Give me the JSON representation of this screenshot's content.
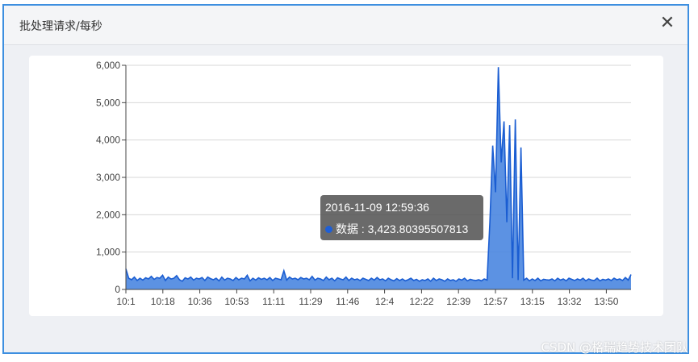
{
  "dialog": {
    "title": "批处理请求/每秒",
    "close_icon": "close-icon",
    "close_glyph": "✕"
  },
  "tooltip": {
    "time": "2016-11-09 12:59:36",
    "series_label": "数据",
    "separator": " : ",
    "value": "3,423.80395507813"
  },
  "watermark": "CSDN @格瑞趋势技术团队",
  "colors": {
    "line": "#1a5dd2",
    "area": "#4a86e0",
    "tooltip_dot": "#1e5fd6",
    "border": "#3d8fe0"
  },
  "chart_data": {
    "type": "area",
    "title": "",
    "xlabel": "",
    "ylabel": "",
    "ylim": [
      0,
      6000
    ],
    "yticks": [
      0,
      1000,
      2000,
      3000,
      4000,
      5000,
      6000
    ],
    "ytick_labels": [
      "0",
      "1,000",
      "2,000",
      "3,000",
      "4,000",
      "5,000",
      "6,000"
    ],
    "xtick_labels": [
      "10:1",
      "10:18",
      "10:36",
      "10:53",
      "11:11",
      "11:29",
      "11:46",
      "12:4",
      "12:22",
      "12:39",
      "12:57",
      "13:15",
      "13:32",
      "13:50"
    ],
    "grid": true,
    "series": [
      {
        "values": [
          550,
          300,
          260,
          330,
          240,
          300,
          250,
          310,
          280,
          350,
          270,
          320,
          300,
          380,
          240,
          330,
          280,
          300,
          370,
          260,
          220,
          310,
          280,
          330,
          250,
          300,
          280,
          320,
          240,
          330,
          290,
          260,
          300,
          230,
          330,
          250,
          300,
          280,
          240,
          320,
          260,
          300,
          280,
          380,
          230,
          300,
          250,
          310,
          270,
          300,
          260,
          320,
          240,
          300,
          280,
          260,
          500,
          250,
          330,
          280,
          300,
          260,
          320,
          280,
          300,
          260,
          350,
          250,
          300,
          280,
          240,
          330,
          260,
          300,
          230,
          310,
          280,
          260,
          330,
          240,
          300,
          260,
          280,
          240,
          300,
          270,
          240,
          300,
          250,
          320,
          260,
          280,
          230,
          300,
          260,
          230,
          290,
          240,
          280,
          230,
          260,
          300,
          240,
          270,
          220,
          260,
          240,
          280,
          220,
          300,
          240,
          280,
          260,
          220,
          280,
          240,
          260,
          220,
          280,
          250,
          300,
          230,
          270,
          250,
          240,
          260,
          230,
          280,
          250,
          1800,
          3850,
          2600,
          5950,
          3400,
          4500,
          1800,
          4400,
          300,
          4550,
          250,
          3800,
          250,
          300,
          230,
          280,
          240,
          300,
          230,
          270,
          260,
          250,
          280,
          230,
          300,
          250,
          280,
          230,
          300,
          270,
          240,
          280,
          250,
          300,
          230,
          280,
          250,
          240,
          300,
          230,
          270,
          250,
          280,
          240,
          300,
          260,
          280,
          240,
          320,
          250,
          400
        ]
      }
    ]
  }
}
